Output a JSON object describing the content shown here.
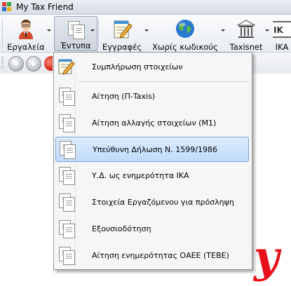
{
  "window": {
    "title": "My Tax Friend"
  },
  "toolbar": {
    "items": [
      {
        "label": "Εργαλεία",
        "icon": "user-avatar-icon"
      },
      {
        "label": "Έντυπα",
        "icon": "documents-icon"
      },
      {
        "label": "Εγγραφές",
        "icon": "notepad-pencil-icon"
      },
      {
        "label": "Χωρίς κωδικούς",
        "icon": "globe-icon"
      },
      {
        "label": "Taxisnet",
        "icon": "building-icon"
      },
      {
        "label": "ΙΚΑ",
        "icon": "ika-logo-icon"
      }
    ]
  },
  "menu": {
    "items": [
      {
        "label": "Συμπλήρωση στοιχείων",
        "icon": "notepad-pencil-icon"
      },
      {
        "label": "Αίτηση (Π-Taxis)",
        "icon": "documents-icon"
      },
      {
        "label": "Αίτηση αλλαγής στοιχείων (Μ1)",
        "icon": "documents-icon"
      },
      {
        "label": "Υπεύθυνη Δήλωση Ν. 1599/1986",
        "icon": "documents-icon"
      },
      {
        "label": "Υ.Δ. ως ενημερότητα ΙΚΑ",
        "icon": "documents-icon"
      },
      {
        "label": "Στοιχεία Εργαζόμενου για πρόσληψη",
        "icon": "documents-icon"
      },
      {
        "label": "Εξουσιοδότηση",
        "icon": "documents-icon"
      },
      {
        "label": "Αίτηση ενημερότητας ΟΑΕΕ (ΤΕΒΕ)",
        "icon": "documents-icon"
      }
    ],
    "highlighted_index": 3
  },
  "logo": {
    "glyph": "y"
  },
  "colors": {
    "menu_highlight": "#c1dbfc",
    "logo_red": "#e8101a"
  }
}
